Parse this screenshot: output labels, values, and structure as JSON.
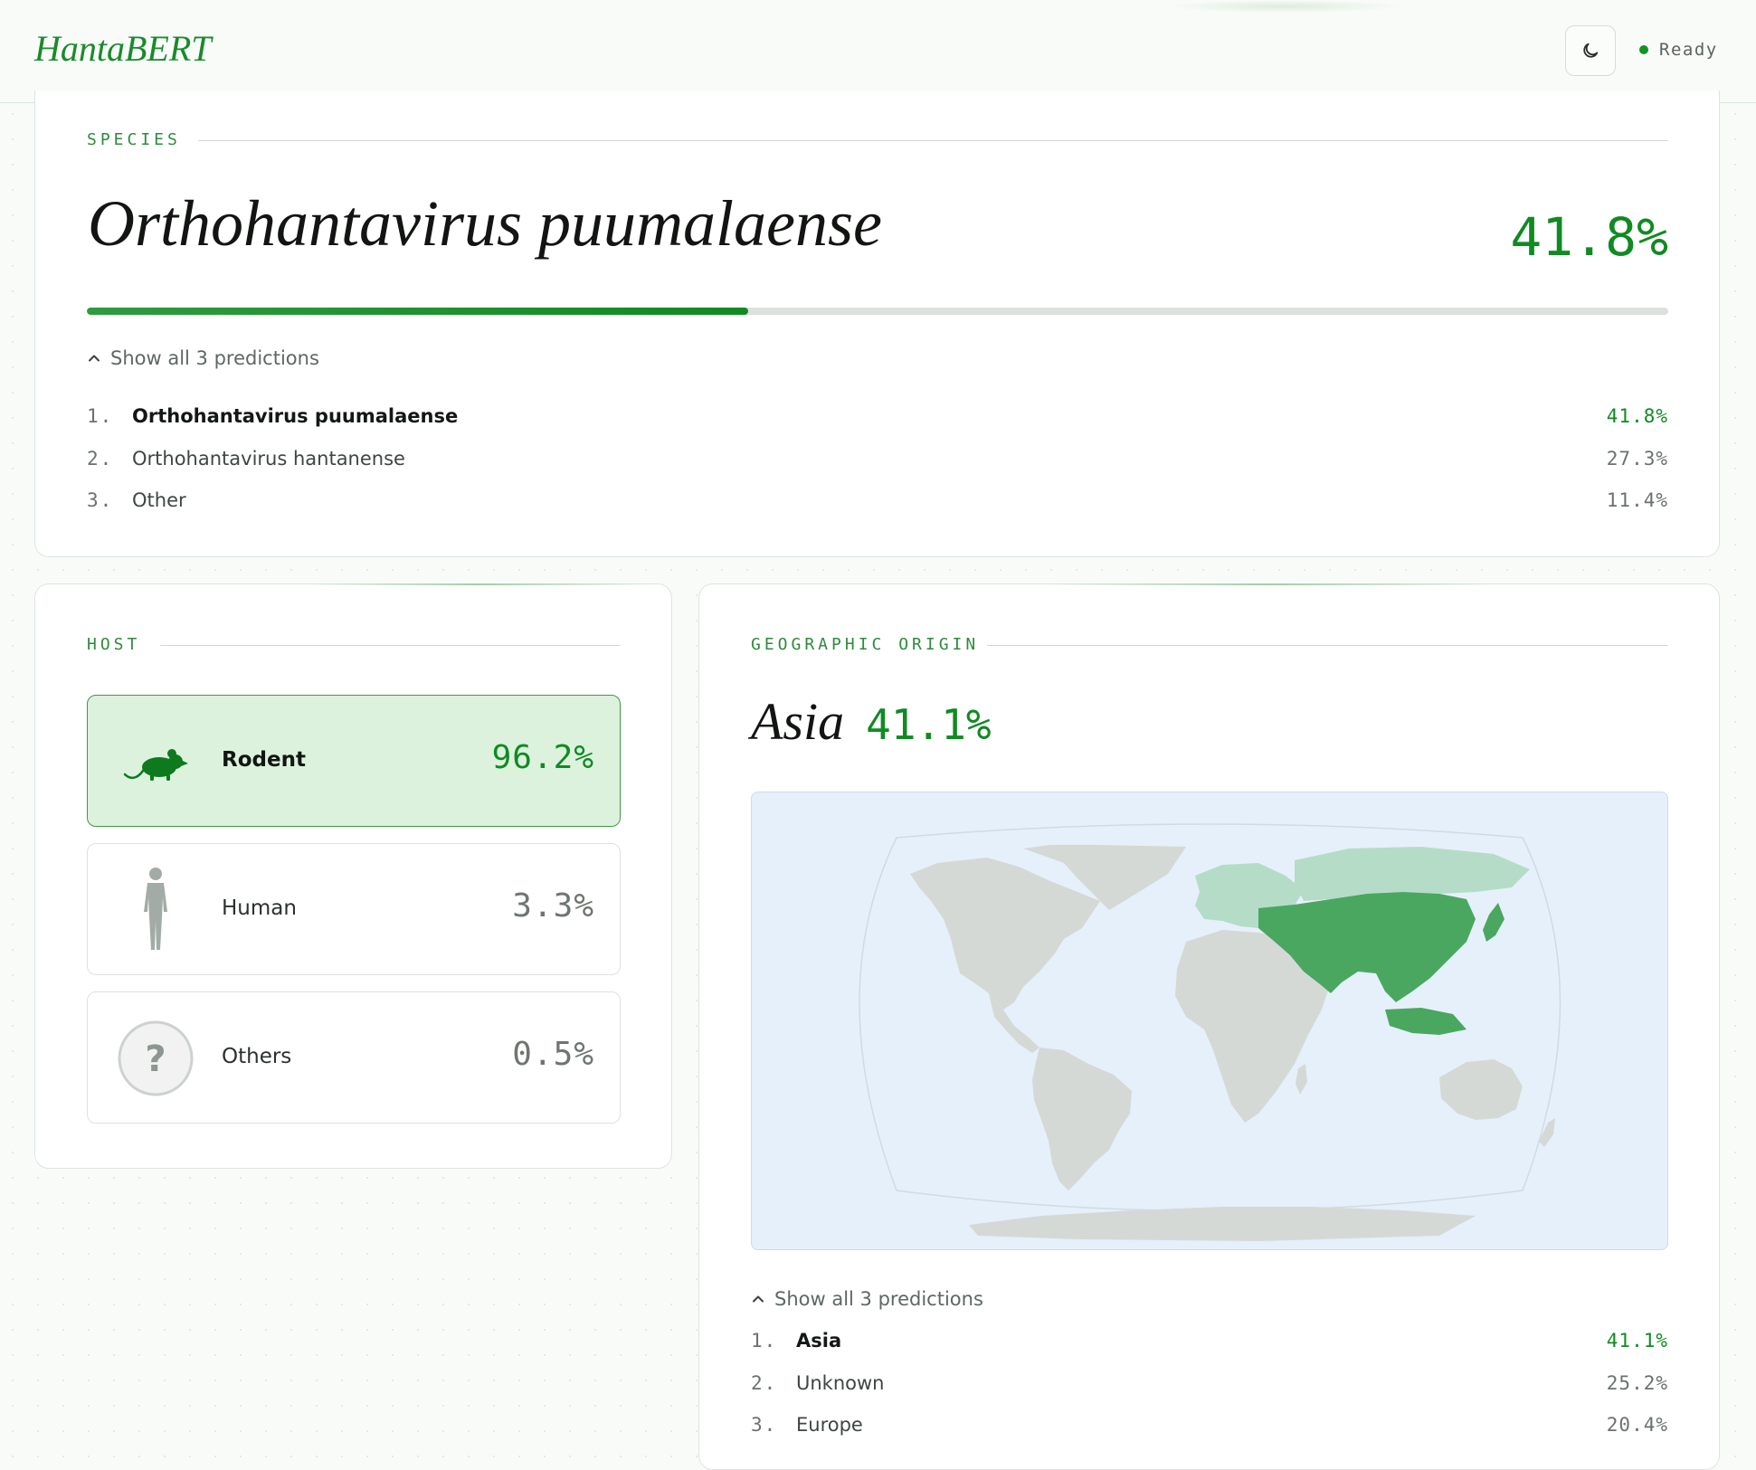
{
  "header": {
    "brand": "HantaBERT",
    "status_text": "Ready",
    "theme_icon": "moon-icon"
  },
  "species": {
    "label": "SPECIES",
    "top_name": "Orthohantavirus puumalaense",
    "top_pct": "41.8%",
    "confidence": 0.418,
    "toggle_label": "Show all 3 predictions",
    "predictions": [
      {
        "rank": "1.",
        "name": "Orthohantavirus puumalaense",
        "pct": "41.8%"
      },
      {
        "rank": "2.",
        "name": "Orthohantavirus hantanense",
        "pct": "27.3%"
      },
      {
        "rank": "3.",
        "name": "Other",
        "pct": "11.4%"
      }
    ]
  },
  "host": {
    "label": "HOST",
    "items": [
      {
        "name": "Rodent",
        "pct": "96.2%",
        "icon": "rodent-icon",
        "selected": true
      },
      {
        "name": "Human",
        "pct": "3.3%",
        "icon": "human-icon",
        "selected": false
      },
      {
        "name": "Others",
        "pct": "0.5%",
        "icon": "question-icon",
        "selected": false
      }
    ]
  },
  "geo": {
    "label": "GEOGRAPHIC ORIGIN",
    "top_region": "Asia",
    "top_pct": "41.1%",
    "toggle_label": "Show all 3 predictions",
    "predictions": [
      {
        "rank": "1.",
        "name": "Asia",
        "pct": "41.1%"
      },
      {
        "rank": "2.",
        "name": "Unknown",
        "pct": "25.2%"
      },
      {
        "rank": "3.",
        "name": "Europe",
        "pct": "20.4%"
      }
    ],
    "map_colors": {
      "ocean": "#e6f0fa",
      "land": "#d5d9d6",
      "highlight": "#4aa760",
      "secondary": "#b5dcc7"
    }
  },
  "colors": {
    "accent": "#108a22",
    "background": "#f9fbf9"
  }
}
